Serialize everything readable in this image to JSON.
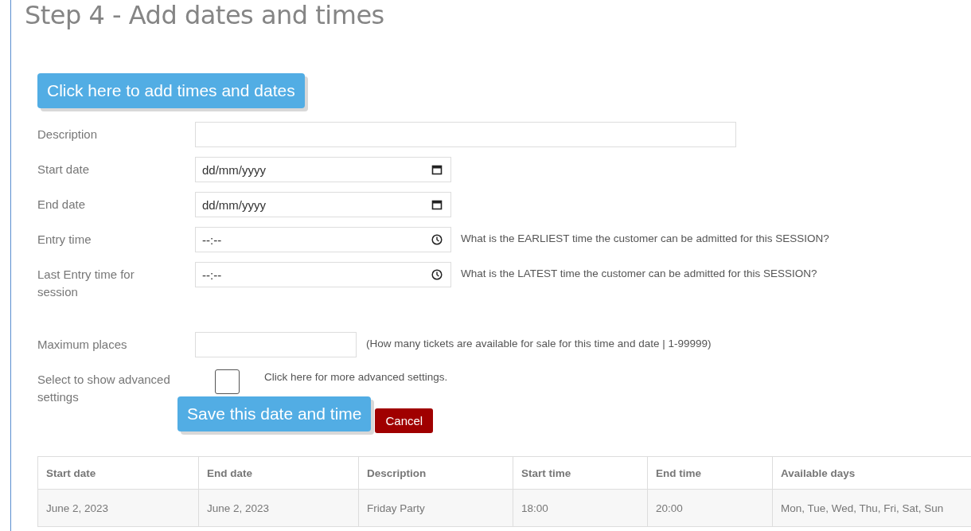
{
  "title": "Step 4 - Add dates and times",
  "add_button": "Click here to add times and dates",
  "fields": [
    {
      "kind": "text",
      "label": "Description"
    },
    {
      "kind": "date",
      "label": "Start date",
      "placeholder": "dd/mm/yyyy"
    },
    {
      "kind": "date",
      "label": "End date",
      "placeholder": "dd/mm/yyyy"
    },
    {
      "kind": "time",
      "label": "Entry time",
      "placeholder": "--:--",
      "hint": "What is the EARLIEST time the customer can be admitted for this SESSION?"
    },
    {
      "kind": "time",
      "label": "Last Entry time for session",
      "placeholder": "--:--",
      "hint": "What is the LATEST time the customer can be admitted for this SESSION?"
    },
    {
      "kind": "text",
      "label": "Maximum places",
      "hint": "(How many tickets are available for sale for this time and date | 1-99999)"
    }
  ],
  "advanced": {
    "label": "Select to show advanced settings",
    "checked": false,
    "hint": "Click here for more advanced settings."
  },
  "save_button": "Save this date and time",
  "cancel_button": "Cancel",
  "table": {
    "columns": [
      "Start date",
      "End date",
      "Description",
      "Start time",
      "End time",
      "Available days"
    ],
    "rows": [
      [
        "June 2, 2023",
        "June 2, 2023",
        "Friday Party",
        "18:00",
        "20:00",
        "Mon, Tue, Wed, Thu, Fri, Sat, Sun"
      ]
    ]
  }
}
